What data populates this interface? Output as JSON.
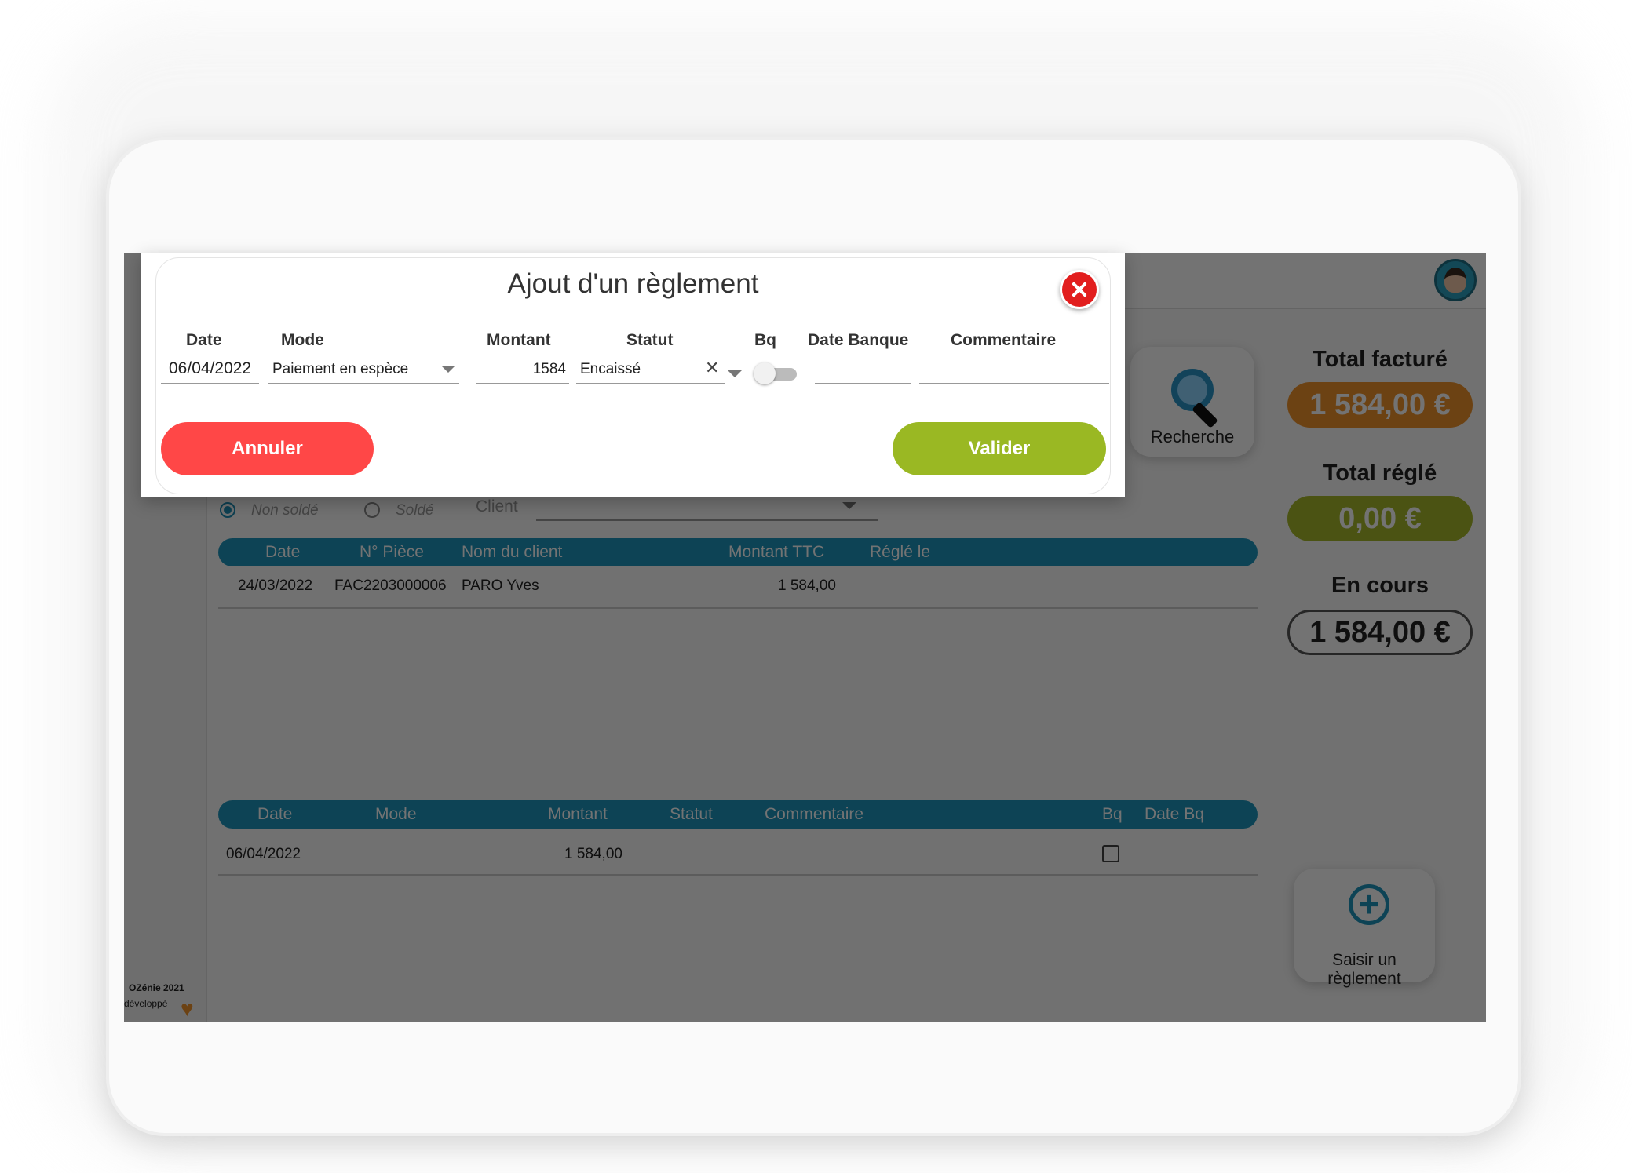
{
  "dialog": {
    "title": "Ajout d'un règlement",
    "headers": {
      "date": "Date",
      "mode": "Mode",
      "montant": "Montant",
      "statut": "Statut",
      "bq": "Bq",
      "date_banque": "Date Banque",
      "commentaire": "Commentaire"
    },
    "values": {
      "date": "06/04/2022",
      "mode": "Paiement en espèce",
      "montant": "1584",
      "statut": "Encaissé",
      "bq_checked": false,
      "date_banque": "",
      "commentaire": ""
    },
    "cancel_label": "Annuler",
    "validate_label": "Valider"
  },
  "search": {
    "label": "Recherche"
  },
  "totals": {
    "facture_label": "Total facturé",
    "facture_value": "1 584,00 €",
    "regle_label": "Total réglé",
    "regle_value": "0,00 €",
    "encours_label": "En cours",
    "encours_value": "1 584,00 €"
  },
  "filters": {
    "non_solde": "Non soldé",
    "solde": "Soldé",
    "client_label": "Client"
  },
  "invoices_table": {
    "headers": [
      "Date",
      "N° Pièce",
      "Nom du client",
      "Montant TTC",
      "Réglé le"
    ],
    "rows": [
      {
        "date": "24/03/2022",
        "piece": "FAC2203000006",
        "client": "PARO Yves",
        "montant": "1 584,00",
        "regle": ""
      }
    ]
  },
  "payments_table": {
    "headers": [
      "Date",
      "Mode",
      "Montant",
      "Statut",
      "Commentaire",
      "Bq",
      "Date Bq"
    ],
    "rows": [
      {
        "date": "06/04/2022",
        "mode": "",
        "montant": "1 584,00",
        "statut": "",
        "commentaire": "",
        "bq": false,
        "date_bq": ""
      }
    ]
  },
  "add_payment": {
    "label": "Saisir un règlement"
  },
  "footer": {
    "line1": "OZénie 2021",
    "line2": "développé"
  },
  "colors": {
    "accent": "#1e96bc",
    "orange": "#f0922a",
    "olive": "#a6b82a",
    "cancel": "#ff4747",
    "validate": "#9ab823",
    "close": "#e21e1e"
  }
}
